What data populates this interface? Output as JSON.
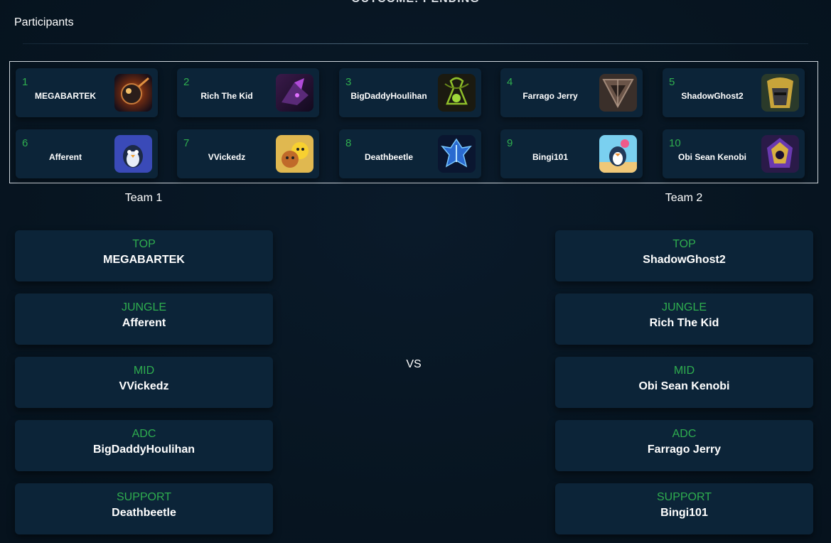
{
  "outcome_text": "OUTCOME: PENDING",
  "participants_title": "Participants",
  "participants": [
    {
      "num": "1",
      "name": "MEGABARTEK",
      "icon": "dark-orb-champion-icon"
    },
    {
      "num": "2",
      "name": "Rich The Kid",
      "icon": "purple-void-creature-icon"
    },
    {
      "num": "3",
      "name": "BigDaddyHoulihan",
      "icon": "green-chemtech-flask-icon"
    },
    {
      "num": "4",
      "name": "Farrago Jerry",
      "icon": "bronze-triangle-emblem-icon"
    },
    {
      "num": "5",
      "name": "ShadowGhost2",
      "icon": "armored-knight-icon"
    },
    {
      "num": "6",
      "name": "Afferent",
      "icon": "penguin-wizard-icon"
    },
    {
      "num": "7",
      "name": "VVickedz",
      "icon": "yellow-cat-friends-icon"
    },
    {
      "num": "8",
      "name": "Deathbeetle",
      "icon": "blue-ice-crest-icon"
    },
    {
      "num": "9",
      "name": "Bingi101",
      "icon": "beach-penguin-icon"
    },
    {
      "num": "10",
      "name": "Obi Sean Kenobi",
      "icon": "gold-purple-helmet-icon"
    }
  ],
  "vs_text": "VS",
  "teams": [
    {
      "title": "Team 1",
      "roles": [
        {
          "role": "TOP",
          "player": "MEGABARTEK"
        },
        {
          "role": "JUNGLE",
          "player": "Afferent"
        },
        {
          "role": "MID",
          "player": "VVickedz"
        },
        {
          "role": "ADC",
          "player": "BigDaddyHoulihan"
        },
        {
          "role": "SUPPORT",
          "player": "Deathbeetle"
        }
      ]
    },
    {
      "title": "Team 2",
      "roles": [
        {
          "role": "TOP",
          "player": "ShadowGhost2"
        },
        {
          "role": "JUNGLE",
          "player": "Rich The Kid"
        },
        {
          "role": "MID",
          "player": "Obi Sean Kenobi"
        },
        {
          "role": "ADC",
          "player": "Farrago Jerry"
        },
        {
          "role": "SUPPORT",
          "player": "Bingi101"
        }
      ]
    }
  ],
  "colors": {
    "background": "#071521",
    "card": "#0c2438",
    "role_accent": "#2fae4f",
    "text": "#ffffff"
  }
}
